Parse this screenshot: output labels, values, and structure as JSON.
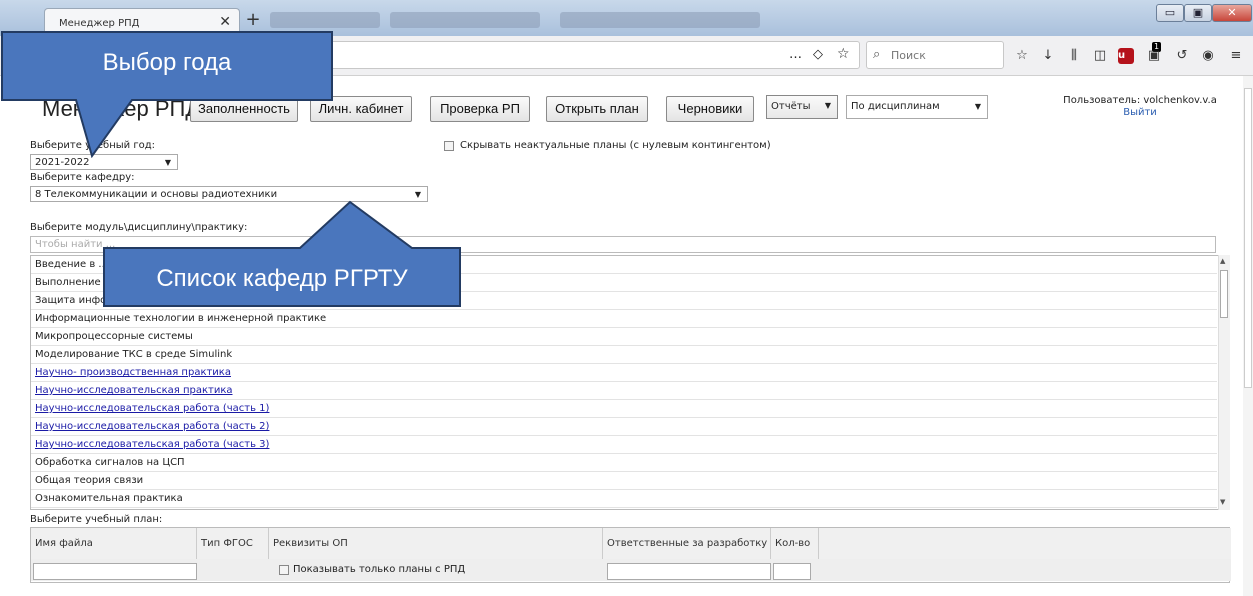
{
  "browser": {
    "tab_title": "Менеджер РПД",
    "tab_close": "✕",
    "new_tab": "+",
    "search_placeholder": "Поиск",
    "more_icon": "…",
    "window_buttons": {
      "minimize": "▭",
      "maximize": "▣",
      "close": "✕"
    },
    "ublock_badge": "1"
  },
  "header": {
    "app_title": "Менеджер РПД",
    "buttons": [
      "Заполненность",
      "Личн. кабинет",
      "Проверка РП",
      "Открыть план",
      "Черновики"
    ],
    "reports_label": "Отчёты",
    "view_select": "По дисциплинам",
    "user_label": "Пользователь: volchenkov.v.a",
    "logout": "Выйти"
  },
  "filters": {
    "year_label": "Выберите учебный год:",
    "year_value": "2021-2022",
    "department_label": "Выберите кафедру:",
    "department_value": "8 Телекоммуникации и основы радиотехники",
    "hide_irrelevant_label": "Скрывать неактуальные планы (с нулевым контингентом)",
    "module_label": "Выберите модуль\\дисциплину\\практику:",
    "search_placeholder": "Чтобы найти ..."
  },
  "disciplines": [
    {
      "name": "Введение в ...",
      "link": false
    },
    {
      "name": "Выполнение ...",
      "link": false
    },
    {
      "name": "Защита инфо...",
      "link": false
    },
    {
      "name": "Информационные технологии в инженерной практике",
      "link": false
    },
    {
      "name": "Микропроцессорные системы",
      "link": false
    },
    {
      "name": "Моделирование ТКС в среде Simulink",
      "link": false
    },
    {
      "name": "Научно- производственная практика",
      "link": true
    },
    {
      "name": "Научно-исследовательская практика",
      "link": true
    },
    {
      "name": "Научно-исследовательская работа (часть 1)",
      "link": true
    },
    {
      "name": "Научно-исследовательская работа (часть 2)",
      "link": true
    },
    {
      "name": "Научно-исследовательская работа (часть 3)",
      "link": true
    },
    {
      "name": "Обработка сигналов на ЦСП",
      "link": false
    },
    {
      "name": "Общая теория связи",
      "link": false
    },
    {
      "name": "Ознакомительная практика",
      "link": false
    }
  ],
  "plan": {
    "label": "Выберите учебный план:",
    "columns": [
      "Имя файла",
      "Тип ФГОС",
      "Реквизиты ОП",
      "Ответственные за разработку",
      "Кол-во"
    ],
    "only_rpd_label": "Показывать только планы с РПД"
  },
  "callouts": {
    "year": "Выбор года",
    "departments": "Список кафедр РГРТУ"
  }
}
